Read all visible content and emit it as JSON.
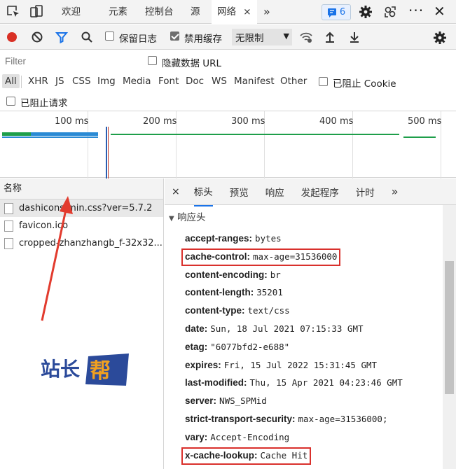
{
  "tabbar": {
    "tabs": [
      "欢迎",
      "元素",
      "控制台",
      "源",
      "网络"
    ],
    "active_tab": "网络",
    "close": "×",
    "more": "»",
    "issues_count": "6"
  },
  "toolbar": {
    "preserve_log": "保留日志",
    "disable_cache": "禁用缓存",
    "throttle": "无限制"
  },
  "filter": {
    "placeholder": "Filter",
    "hide_data_url": "隐藏数据 URL"
  },
  "types": [
    "All",
    "XHR",
    "JS",
    "CSS",
    "Img",
    "Media",
    "Font",
    "Doc",
    "WS",
    "Manifest",
    "Other"
  ],
  "blocked_cookies": "已阻止 Cookie",
  "blocked_requests": "已阻止请求",
  "timeline": {
    "ticks": [
      "100 ms",
      "200 ms",
      "300 ms",
      "400 ms",
      "500 ms"
    ]
  },
  "requests": {
    "header": "名称",
    "items": [
      "dashicons.min.css?ver=5.7.2",
      "favicon.ico",
      "cropped-zhanzhangb_f-32x32...."
    ]
  },
  "detail": {
    "close": "×",
    "tabs": [
      "标头",
      "预览",
      "响应",
      "发起程序",
      "计时"
    ],
    "more": "»",
    "section": "响应头",
    "headers": [
      {
        "key": "accept-ranges:",
        "value": "bytes"
      },
      {
        "key": "cache-control:",
        "value": "max-age=31536000"
      },
      {
        "key": "content-encoding:",
        "value": "br"
      },
      {
        "key": "content-length:",
        "value": "35201"
      },
      {
        "key": "content-type:",
        "value": "text/css"
      },
      {
        "key": "date:",
        "value": "Sun, 18 Jul 2021 07:15:33 GMT"
      },
      {
        "key": "etag:",
        "value": "\"6077bfd2-e688\""
      },
      {
        "key": "expires:",
        "value": "Fri, 15 Jul 2022 15:31:45 GMT"
      },
      {
        "key": "last-modified:",
        "value": "Thu, 15 Apr 2021 04:23:46 GMT"
      },
      {
        "key": "server:",
        "value": "NWS_SPMid"
      },
      {
        "key": "strict-transport-security:",
        "value": "max-age=31536000;"
      },
      {
        "key": "vary:",
        "value": "Accept-Encoding"
      },
      {
        "key": "x-cache-lookup:",
        "value": "Cache Hit"
      }
    ]
  },
  "logo": {
    "text": "站长帮"
  },
  "colors": {
    "accent": "#1a73e8",
    "record": "#d93025",
    "highlight": "#d9302c",
    "bar_green": "#1e9e4a",
    "bar_blue": "#2a8ad4"
  }
}
